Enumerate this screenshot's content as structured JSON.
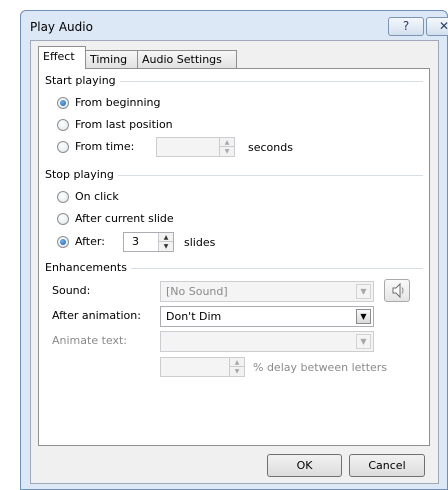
{
  "window": {
    "title": "Play Audio",
    "help_glyph": "?",
    "close_glyph": "✕"
  },
  "tabs": [
    {
      "label": "Effect",
      "selected": true
    },
    {
      "label": "Timing",
      "selected": false
    },
    {
      "label": "Audio Settings",
      "selected": false
    }
  ],
  "start_playing": {
    "heading": "Start playing",
    "options": [
      {
        "label": "From beginning",
        "checked": true
      },
      {
        "label": "From last position",
        "checked": false
      },
      {
        "label": "From time:",
        "checked": false
      }
    ],
    "time_value": "",
    "time_unit": "seconds"
  },
  "stop_playing": {
    "heading": "Stop playing",
    "options": [
      {
        "label": "On click",
        "checked": false
      },
      {
        "label": "After current slide",
        "checked": false
      },
      {
        "label": "After:",
        "checked": true
      }
    ],
    "after_value": "3",
    "after_unit": "slides"
  },
  "enhancements": {
    "heading": "Enhancements",
    "sound_label": "Sound:",
    "sound_value": "[No Sound]",
    "after_animation_label": "After animation:",
    "after_animation_value": "Don't Dim",
    "animate_text_label": "Animate text:",
    "animate_text_value": "",
    "delay_value": "",
    "delay_label": "% delay between letters",
    "speaker_icon": "speaker-icon"
  },
  "buttons": {
    "ok": "OK",
    "cancel": "Cancel"
  },
  "colors": {
    "frame": "#dce8f5",
    "radio_dot": "#1d5ea8"
  }
}
